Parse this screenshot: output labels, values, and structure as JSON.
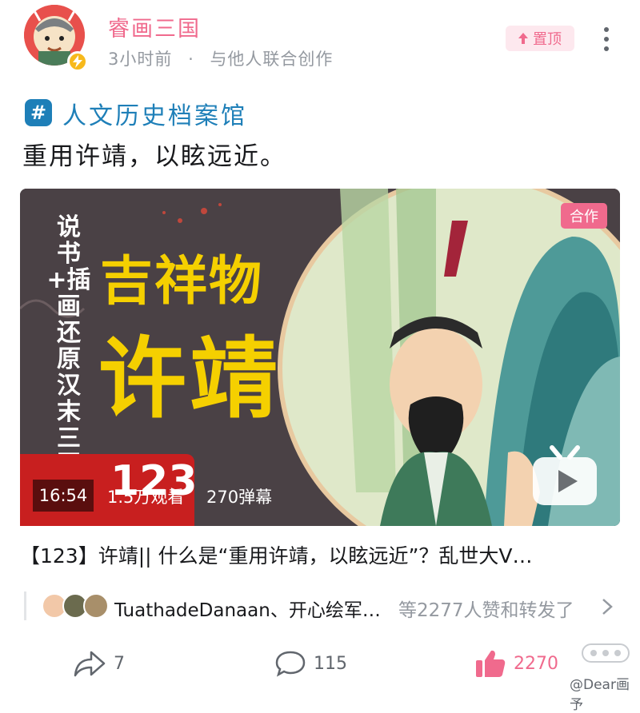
{
  "header": {
    "author": "睿画三国",
    "time": "3小时前",
    "separator": "·",
    "collab_note": "与他人联合创作",
    "pin_label": "置顶"
  },
  "topic": {
    "icon": "#",
    "name": "人文历史档案馆"
  },
  "post_text": "重用许靖，以眩远近。",
  "video": {
    "coop_badge": "合作",
    "thumb_vertical_text": "说书+插画还原汉末三国史料",
    "thumb_title_1": "吉祥物",
    "thumb_title_2": "许靖",
    "thumb_number": "123",
    "duration": "16:54",
    "views": "1.5万观看",
    "danmaku": "270弹幕",
    "title": "【123】许靖|| 什么是“重用许靖，以眩远近”？乱世大V…"
  },
  "likes": {
    "likers": "TuathadeDanaan、开心绘军…",
    "summary": "等2277人赞和转发了"
  },
  "actions": {
    "share_count": "7",
    "comment_count": "115",
    "like_count": "2270"
  },
  "watermark": "@Dear画予",
  "colors": {
    "brand_pink": "#f06a8d",
    "topic_blue": "#1e7fb8",
    "muted_gray": "#9499a0"
  }
}
